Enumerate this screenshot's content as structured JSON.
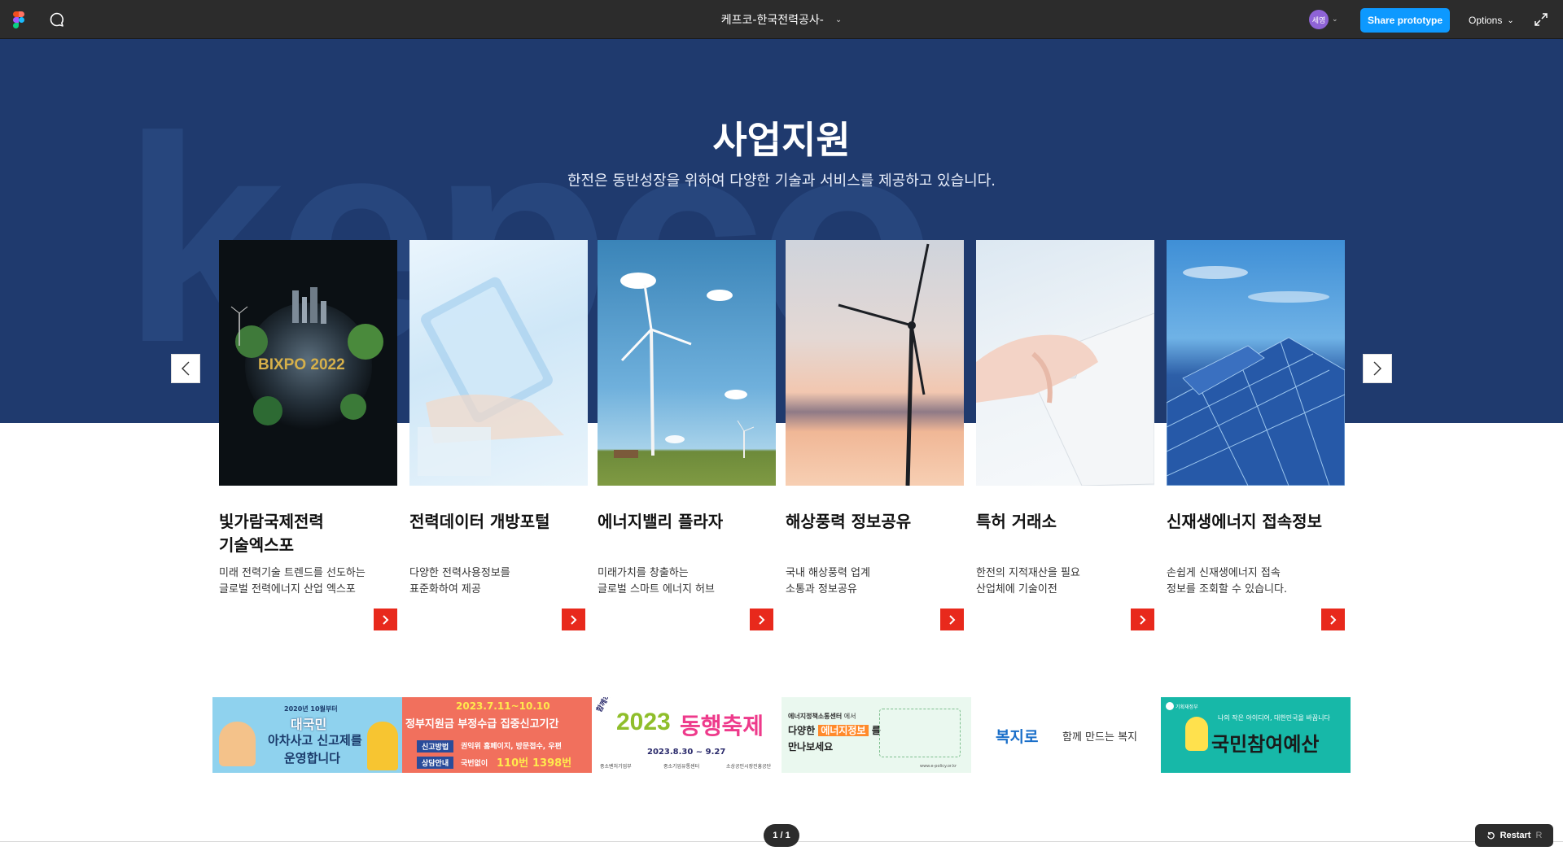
{
  "toolbar": {
    "file_title": "케프코-한국전력공사-",
    "avatar_initials": "세영",
    "share_label": "Share prototype",
    "options_label": "Options"
  },
  "hero": {
    "title": "사업지원",
    "subtitle": "한전은 동반성장을 위하여 다양한 기술과 서비스를 제공하고 있습니다."
  },
  "cards": [
    {
      "title": "빛가람국제전력\n기술엑스포",
      "desc": "미래 전력기술 트렌드를 선도하는\n글로벌 전력에너지 산업 엑스포",
      "image": "bixpo-globe",
      "image_text": "BIXPO 2022"
    },
    {
      "title": "전력데이터 개방포털",
      "desc": "다양한 전력사용정보를\n표준화하여 제공",
      "image": "tablet-hand"
    },
    {
      "title": "에너지밸리 플라자",
      "desc": "미래가치를 창출하는\n글로벌 스마트 에너지 허브",
      "image": "wind-turbine-sky"
    },
    {
      "title": "해상풍력 정보공유",
      "desc": "국내 해상풍력 업계\n소통과 정보공유",
      "image": "wind-turbine-sunset"
    },
    {
      "title": "특허 거래소",
      "desc": "한전의 지적재산을 필요\n산업체에 기술이전",
      "image": "keyboard-hands"
    },
    {
      "title": "신재생에너지 접속정보",
      "desc": "손쉽게 신재생에너지 접속\n정보를 조회할 수 있습니다.",
      "image": "solar-panels"
    }
  ],
  "banners": {
    "b1": {
      "top": "2020년 10월부터",
      "line1": "대국민",
      "line2": "아차사고 신고제를",
      "line3": "운영합니다"
    },
    "b2": {
      "date": "2023.7.11~10.10",
      "title": "정부지원금 부정수급 집중신고기간",
      "row1_label": "신고방법",
      "row1_text": "권익위 홈페이지, 방문접수, 우편",
      "row2_label": "상담안내",
      "row2_text": "국번없이",
      "row2_num1": "110번",
      "row2_num2": "1398번"
    },
    "b3": {
      "tag": "함께하면 대박나는",
      "year": "2023",
      "name": "동행축제",
      "dates": "2023.8.30 ~ 9.27",
      "org1": "중소벤처기업부",
      "org2": "중소기업유통센터",
      "org3": "소상공인시장진흥공단"
    },
    "b4": {
      "top": "에너지정책소통센터",
      "top2": "에서",
      "line1": "다양한",
      "highlight": "에너지정보",
      "line1b": "를",
      "line2": "만나보세요",
      "url": "www.e-policy.or.kr"
    },
    "b5": {
      "logo": "복지로",
      "text": "함께 만드는 복지"
    },
    "b6": {
      "ministry": "기획재정부",
      "small": "나의 작은 아이디어, 대한민국을 바꿉니다",
      "title": "국민참여예산"
    }
  },
  "footer": {
    "page": "1 / 1",
    "restart": "Restart",
    "restart_key": "R"
  },
  "colors": {
    "toolbar": "#2c2c2c",
    "share": "#0d99ff",
    "hero": "#1f3a6e",
    "card_go": "#e8291c"
  }
}
